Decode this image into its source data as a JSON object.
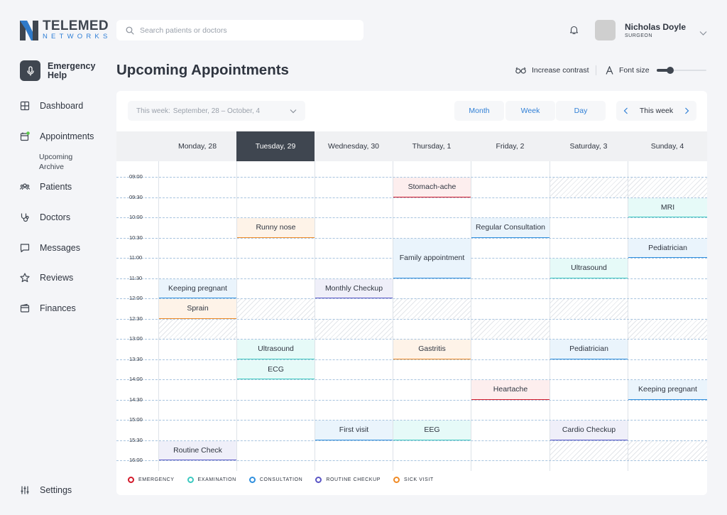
{
  "brand": {
    "name": "TELEMED",
    "sub": "NETWORKS"
  },
  "emergency": {
    "label": "Emergency Help"
  },
  "nav": [
    {
      "label": "Dashboard",
      "icon": "grid-icon"
    },
    {
      "label": "Appointments",
      "icon": "calendar-icon",
      "sub": [
        "Upcoming",
        "Archive"
      ]
    },
    {
      "label": "Patients",
      "icon": "users-icon"
    },
    {
      "label": "Doctors",
      "icon": "stethoscope-icon"
    },
    {
      "label": "Messages",
      "icon": "message-icon"
    },
    {
      "label": "Reviews",
      "icon": "star-icon"
    },
    {
      "label": "Finances",
      "icon": "wallet-icon"
    }
  ],
  "settings": {
    "label": "Settings"
  },
  "search": {
    "placeholder": "Search patients or doctors"
  },
  "user": {
    "name": "Nicholas Doyle",
    "role": "SURGEON"
  },
  "page_title": "Upcoming Appointments",
  "accessibility": {
    "contrast": "Increase contrast",
    "font_size": "Font size",
    "font_level": 0.27
  },
  "calendar": {
    "week_label": "This week:",
    "week_range": "September, 28 – October, 4",
    "views": [
      "Month",
      "Week",
      "Day"
    ],
    "nav_label": "This week",
    "days": [
      "Monday, 28",
      "Tuesday, 29",
      "Wednesday, 30",
      "Thursday, 1",
      "Friday, 2",
      "Saturday, 3",
      "Sunday, 4"
    ],
    "today_index": 1,
    "times": [
      "09:00",
      "09:30",
      "10:00",
      "10:30",
      "11:00",
      "11:30",
      "12:00",
      "12:30",
      "13:00",
      "13:30",
      "14:00",
      "14:30",
      "15:00",
      "15:30",
      "16:00"
    ],
    "unavailable": [
      {
        "day": 5,
        "start": 0,
        "end": 1
      },
      {
        "day": 6,
        "start": 0,
        "end": 1
      },
      {
        "day": 1,
        "start": 6,
        "end": 7
      },
      {
        "day": 3,
        "start": 6,
        "end": 7
      },
      {
        "day": 5,
        "start": 6,
        "end": 7
      },
      {
        "day": 0,
        "start": 7,
        "end": 8
      },
      {
        "day": 2,
        "start": 7,
        "end": 8
      },
      {
        "day": 4,
        "start": 7,
        "end": 8
      },
      {
        "day": 6,
        "start": 7,
        "end": 8
      },
      {
        "day": 5,
        "start": 13,
        "end": 14
      },
      {
        "day": 6,
        "start": 13,
        "end": 14
      }
    ],
    "appointments": [
      {
        "day": 3,
        "start": 0,
        "end": 1,
        "title": "Stomach-ache",
        "type": "emergency"
      },
      {
        "day": 6,
        "start": 1,
        "end": 2,
        "title": "MRI",
        "type": "examination"
      },
      {
        "day": 1,
        "start": 2,
        "end": 3,
        "title": "Runny nose",
        "type": "sick"
      },
      {
        "day": 4,
        "start": 2,
        "end": 3,
        "title": "Regular Consultation",
        "type": "consultation"
      },
      {
        "day": 3,
        "start": 3,
        "end": 5,
        "title": "Family appointment",
        "type": "consultation"
      },
      {
        "day": 6,
        "start": 3,
        "end": 4,
        "title": "Pediatrician",
        "type": "consultation"
      },
      {
        "day": 5,
        "start": 4,
        "end": 5,
        "title": "Ultrasound",
        "type": "examination"
      },
      {
        "day": 0,
        "start": 5,
        "end": 6,
        "title": "Keeping pregnant",
        "type": "consultation"
      },
      {
        "day": 2,
        "start": 5,
        "end": 6,
        "title": "Monthly Checkup",
        "type": "routine"
      },
      {
        "day": 0,
        "start": 6,
        "end": 7,
        "title": "Sprain",
        "type": "sick"
      },
      {
        "day": 1,
        "start": 8,
        "end": 9,
        "title": "Ultrasound",
        "type": "examination"
      },
      {
        "day": 3,
        "start": 8,
        "end": 9,
        "title": "Gastritis",
        "type": "sick"
      },
      {
        "day": 5,
        "start": 8,
        "end": 9,
        "title": "Pediatrician",
        "type": "consultation"
      },
      {
        "day": 1,
        "start": 9,
        "end": 10,
        "title": "ECG",
        "type": "examination"
      },
      {
        "day": 4,
        "start": 10,
        "end": 11,
        "title": "Heartache",
        "type": "emergency"
      },
      {
        "day": 6,
        "start": 10,
        "end": 11,
        "title": "Keeping pregnant",
        "type": "consultation"
      },
      {
        "day": 2,
        "start": 12,
        "end": 13,
        "title": "First visit",
        "type": "consultation"
      },
      {
        "day": 3,
        "start": 12,
        "end": 13,
        "title": "EEG",
        "type": "examination"
      },
      {
        "day": 5,
        "start": 12,
        "end": 13,
        "title": "Cardio Checkup",
        "type": "routine"
      },
      {
        "day": 0,
        "start": 13,
        "end": 14,
        "title": "Routine Check",
        "type": "routine"
      }
    ],
    "legend": [
      {
        "key": "emergency",
        "label": "EMERGENCY"
      },
      {
        "key": "examination",
        "label": "EXAMINATION"
      },
      {
        "key": "consultation",
        "label": "CONSULTATION"
      },
      {
        "key": "routine",
        "label": "ROUTINE CHECKUP"
      },
      {
        "key": "sick",
        "label": "SICK VISIT"
      }
    ]
  },
  "colors": {
    "emergency": {
      "line": "#d3192a",
      "bg": "#fdeeee"
    },
    "examination": {
      "line": "#3cc9c0",
      "bg": "#e6faf8"
    },
    "consultation": {
      "line": "#2f8fde",
      "bg": "#eaf4fc"
    },
    "routine": {
      "line": "#5a55c5",
      "bg": "#efeff9"
    },
    "sick": {
      "line": "#f08a24",
      "bg": "#fef3e8"
    },
    "accent": "#2f7fd6",
    "dark": "#3f4650"
  }
}
